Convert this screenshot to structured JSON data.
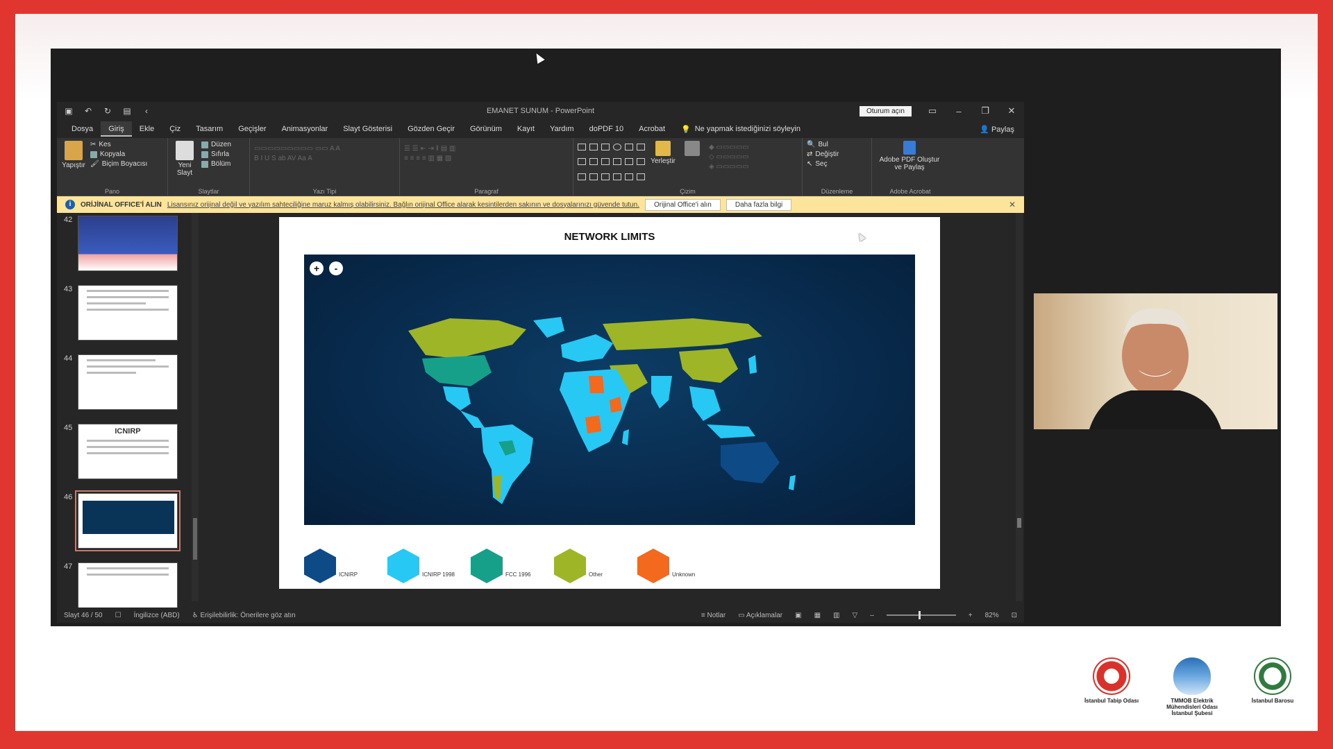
{
  "powerpoint": {
    "window_title": "EMANET SUNUM  -  PowerPoint",
    "sign_in": "Oturum açın",
    "tabs": [
      "Dosya",
      "Giriş",
      "Ekle",
      "Çiz",
      "Tasarım",
      "Geçişler",
      "Animasyonlar",
      "Slayt Gösterisi",
      "Gözden Geçir",
      "Görünüm",
      "Kayıt",
      "Yardım",
      "doPDF 10",
      "Acrobat"
    ],
    "tell_me": "Ne yapmak istediğinizi söyleyin",
    "share": "Paylaş",
    "ribbon": {
      "paste": "Yapıştır",
      "cut": "Kes",
      "copy": "Kopyala",
      "format_painter": "Biçim Boyacısı",
      "new_slide": "Yeni Slayt",
      "layout": "Düzen",
      "reset": "Sıfırla",
      "section": "Bölüm",
      "arrange": "Yerleştir",
      "find": "Bul",
      "replace": "Değiştir",
      "select": "Seç",
      "acrobat_btn": "Adobe PDF Oluştur ve Paylaş",
      "groups": {
        "clipboard": "Pano",
        "slides": "Slaytlar",
        "font": "Yazı Tipi",
        "paragraph": "Paragraf",
        "drawing": "Çizim",
        "editing": "Düzenleme",
        "acrobat": "Adobe Acrobat"
      }
    },
    "warning": {
      "title": "ORİJİNAL OFFICE'İ ALIN",
      "message": "Lisansınız orijinal değil ve yazılım sahteciliğine maruz kalmış olabilirsiniz. Bağlın orijinal Office alarak kesintilerden sakının ve dosyalarınızı güvende tutun.",
      "button1": "Orijinal Office'i alın",
      "button2": "Daha fazla bilgi"
    },
    "thumbnails": [
      {
        "num": "42",
        "selected": false
      },
      {
        "num": "43",
        "selected": false
      },
      {
        "num": "44",
        "selected": false
      },
      {
        "num": "45",
        "selected": false,
        "label": "ICNIRP"
      },
      {
        "num": "46",
        "selected": true
      },
      {
        "num": "47",
        "selected": false
      }
    ],
    "slide": {
      "title": "NETWORK LIMITS",
      "zoom_in": "+",
      "zoom_out": "-",
      "legend": [
        {
          "label": "ICNIRP",
          "color": "#0d4a86"
        },
        {
          "label": "ICNIRP 1998",
          "color": "#28c8f5"
        },
        {
          "label": "FCC 1996",
          "color": "#16a08a"
        },
        {
          "label": "Other",
          "color": "#9fb528"
        },
        {
          "label": "Unknown",
          "color": "#f36a1f"
        }
      ]
    },
    "status": {
      "slide_info": "Slayt 46 / 50",
      "language": "İngilizce (ABD)",
      "accessibility": "Erişilebilirlik: Önerilere göz atın",
      "notes": "Notlar",
      "comments": "Açıklamalar",
      "zoom": "82%"
    }
  },
  "logos": [
    {
      "name": "İstanbul Tabip Odası"
    },
    {
      "name": "TMMOB Elektrik Mühendisleri Odası İstanbul Şubesi"
    },
    {
      "name": "İstanbul Barosu"
    }
  ],
  "colors": {
    "frame": "#e0362f",
    "map_bg": "#082a4c"
  }
}
